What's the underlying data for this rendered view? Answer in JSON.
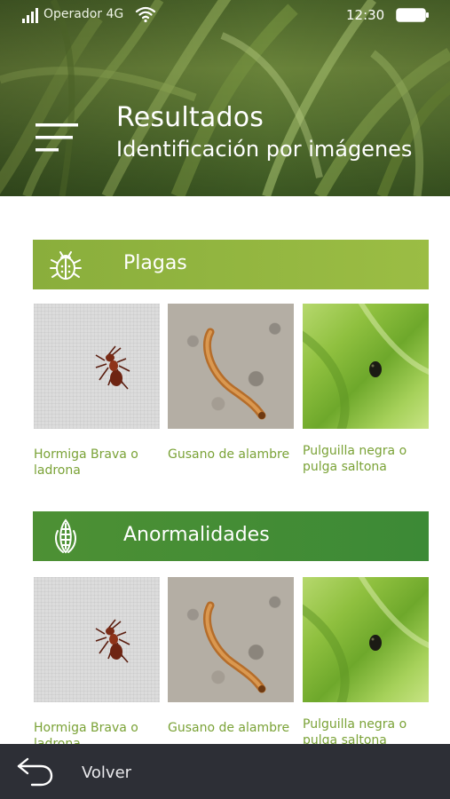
{
  "status_bar": {
    "carrier": "Operador 4G",
    "time": "12:30"
  },
  "header": {
    "title": "Resultados",
    "subtitle": "Identificación por imágenes"
  },
  "sections": [
    {
      "label": "Plagas",
      "icon": "bug-icon",
      "color": "#9bbd44",
      "items": [
        {
          "caption": "Hormiga Brava o ladrona",
          "image": "ant-photo"
        },
        {
          "caption": "Gusano de alambre",
          "image": "wireworm-photo"
        },
        {
          "caption": "Pulguilla negra o pulga saltona",
          "image": "flea-beetle-photo"
        }
      ]
    },
    {
      "label": "Anormalidades",
      "icon": "corn-icon",
      "color": "#3c8a36",
      "items": [
        {
          "caption": "Hormiga Brava o ladrona",
          "image": "ant-photo"
        },
        {
          "caption": "Gusano de alambre",
          "image": "wireworm-photo"
        },
        {
          "caption": "Pulguilla negra o pulga saltona",
          "image": "flea-beetle-photo"
        }
      ]
    }
  ],
  "bottom_bar": {
    "back_label": "Volver",
    "icon": "back-arrow-icon",
    "color": "#2d2f36"
  },
  "colors": {
    "caption": "#7aa236"
  }
}
